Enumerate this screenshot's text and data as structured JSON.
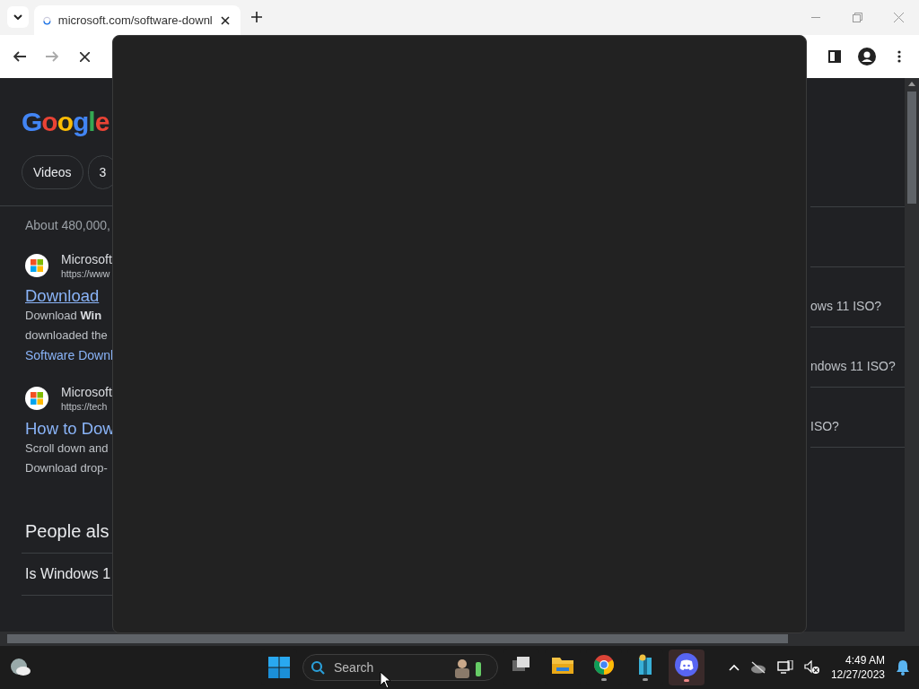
{
  "browser": {
    "tab": {
      "title": "microsoft.com/software-downl",
      "loading": true
    },
    "toolbar": {
      "loading": true
    }
  },
  "page": {
    "logo": "Google",
    "chips": [
      "Videos",
      "3"
    ],
    "stats": "About 480,000,",
    "results": [
      {
        "site": "Microsoft",
        "url": "https://www",
        "title": "Download",
        "visited": true,
        "snippet": [
          "Download **Win**",
          "downloaded the"
        ],
        "link": "Software Downl"
      },
      {
        "site": "Microsoft",
        "url": "https://tech",
        "title": "How to Dow",
        "visited": false,
        "snippet": [
          "Scroll down and",
          "Download drop-"
        ]
      }
    ],
    "people_also": {
      "heading": "People als",
      "items": [
        "Is Windows 1"
      ]
    },
    "right_questions": [
      "ows 11 ISO?",
      "ndows 11 ISO?",
      "ISO?"
    ]
  },
  "taskbar": {
    "search": {
      "placeholder": "Search"
    },
    "apps": [
      {
        "kind": "taskview",
        "running": false,
        "active": false
      },
      {
        "kind": "explorer",
        "running": false,
        "active": false
      },
      {
        "kind": "chrome",
        "running": true,
        "active": false
      },
      {
        "kind": "archive",
        "running": true,
        "active": false
      },
      {
        "kind": "discord",
        "running": true,
        "active": true
      }
    ],
    "time": "4:49 AM",
    "date": "12/27/2023"
  }
}
